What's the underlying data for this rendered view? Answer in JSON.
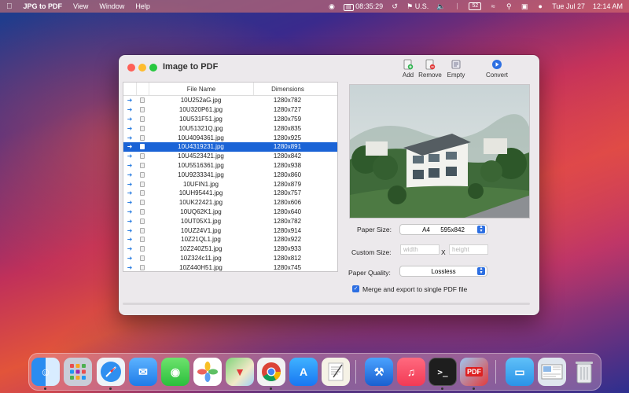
{
  "menubar": {
    "app_name": "JPG to PDF",
    "menus": [
      "View",
      "Window",
      "Help"
    ],
    "status_time_chip": "08:35:29",
    "locale": "U.S.",
    "battery": "52",
    "date": "Tue Jul 27",
    "time": "12:14 AM"
  },
  "window": {
    "title": "Image to PDF",
    "toolbar": {
      "add_label": "Add",
      "remove_label": "Remove",
      "empty_label": "Empty",
      "convert_label": "Convert"
    },
    "table": {
      "headers": {
        "name": "File Name",
        "dimensions": "Dimensions"
      },
      "rows": [
        {
          "name": "10U252aG.jpg",
          "dimensions": "1280x782"
        },
        {
          "name": "10U320P61.jpg",
          "dimensions": "1280x727"
        },
        {
          "name": "10U531F51.jpg",
          "dimensions": "1280x759"
        },
        {
          "name": "10U51321Q.jpg",
          "dimensions": "1280x835"
        },
        {
          "name": "10U4094361.jpg",
          "dimensions": "1280x925"
        },
        {
          "name": "10U4319231.jpg",
          "dimensions": "1280x891",
          "selected": true
        },
        {
          "name": "10U4523421.jpg",
          "dimensions": "1280x842"
        },
        {
          "name": "10U5516361.jpg",
          "dimensions": "1280x938"
        },
        {
          "name": "10U9233341.jpg",
          "dimensions": "1280x860"
        },
        {
          "name": "10UFIN1.jpg",
          "dimensions": "1280x879"
        },
        {
          "name": "10UH95441.jpg",
          "dimensions": "1280x757"
        },
        {
          "name": "10UK22421.jpg",
          "dimensions": "1280x606"
        },
        {
          "name": "10UQ62K1.jpg",
          "dimensions": "1280x640"
        },
        {
          "name": "10UT05X1.jpg",
          "dimensions": "1280x782"
        },
        {
          "name": "10UZ24V1.jpg",
          "dimensions": "1280x914"
        },
        {
          "name": "10Z21QL1.jpg",
          "dimensions": "1280x922"
        },
        {
          "name": "10Z240Z51.jpg",
          "dimensions": "1280x933"
        },
        {
          "name": "10Z324c11.jpg",
          "dimensions": "1280x812"
        },
        {
          "name": "10Z440H51.jpg",
          "dimensions": "1280x745"
        }
      ]
    },
    "settings": {
      "paper_size_label": "Paper Size:",
      "paper_size_value": "A4      595x842",
      "custom_size_label": "Custom Size:",
      "width_placeholder": "width",
      "x_label": "X",
      "height_placeholder": "height",
      "paper_quality_label": "Paper Quality:",
      "paper_quality_value": "Lossless",
      "merge_label": "Merge and export to single PDF file",
      "merge_checked": true
    },
    "progress": 0.0
  },
  "dock": {
    "apps": [
      "finder-icon",
      "launchpad-icon",
      "safari-icon",
      "mail-icon",
      "messages-icon",
      "photos-icon",
      "maps-icon",
      "chrome-icon",
      "app-store-icon",
      "textedit-icon",
      "xcode-icon",
      "music-icon",
      "terminal-icon",
      "jpg-to-pdf-icon",
      "folder-icon",
      "preview-icon",
      "trash-icon"
    ],
    "terminal_text": ">_",
    "pdf_text": "PDF"
  },
  "colors": {
    "accent": "#1a63d6",
    "window_bg": "#ece9ec"
  }
}
